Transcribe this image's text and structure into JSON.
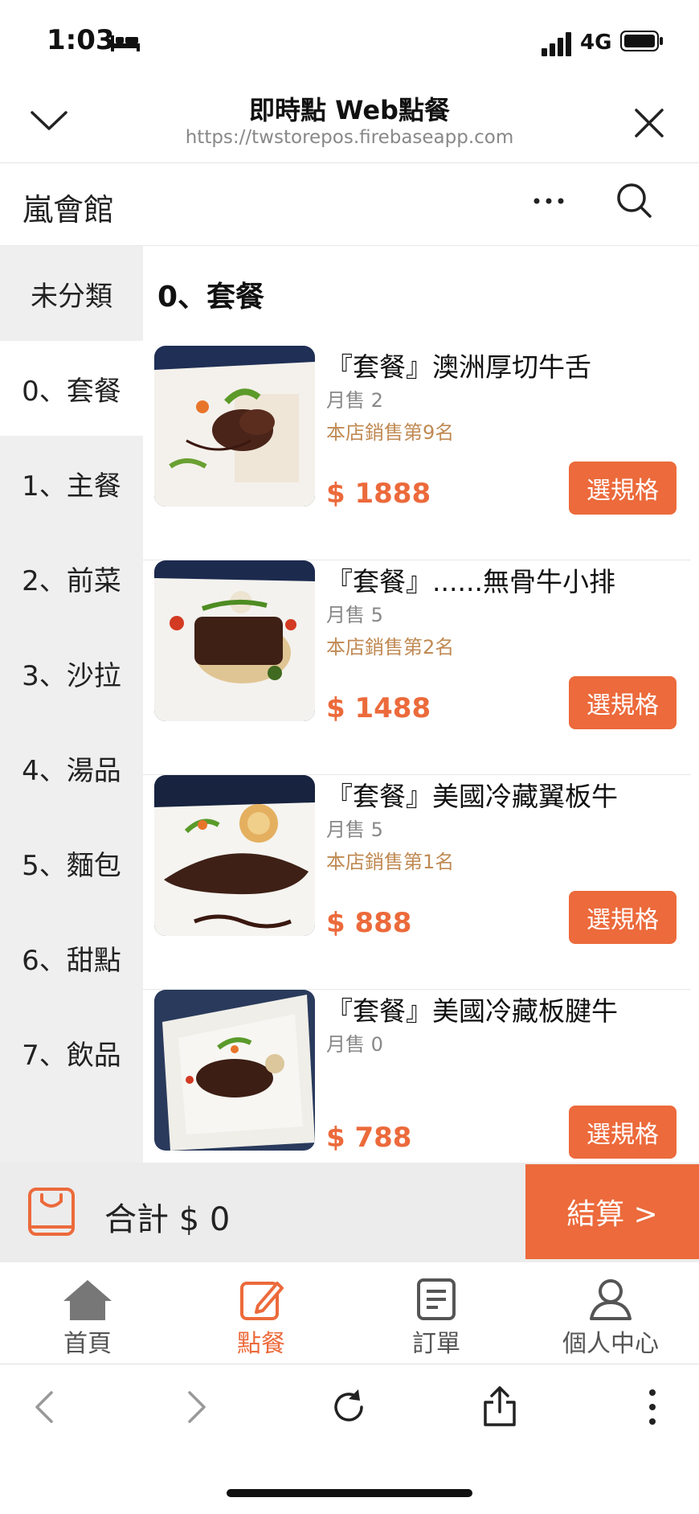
{
  "status": {
    "time": "1:03",
    "network": "4G"
  },
  "browser": {
    "title": "即時點 Web點餐",
    "url": "https://twstorepos.firebaseapp.com"
  },
  "shop": {
    "name": "嵐會館"
  },
  "categories": [
    {
      "label": "未分類"
    },
    {
      "label": "0、套餐"
    },
    {
      "label": "1、主餐"
    },
    {
      "label": "2、前菜"
    },
    {
      "label": "3、沙拉"
    },
    {
      "label": "4、湯品"
    },
    {
      "label": "5、麵包"
    },
    {
      "label": "6、甜點"
    },
    {
      "label": "7、飲品"
    }
  ],
  "section": {
    "title": "0、套餐"
  },
  "items": [
    {
      "name": "『套餐』澳洲厚切牛舌",
      "sold": "月售 2",
      "rank": "本店銷售第9名",
      "price": "$ 1888",
      "button": "選規格"
    },
    {
      "name": "『套餐』......無骨牛小排",
      "sold": "月售 5",
      "rank": "本店銷售第2名",
      "price": "$ 1488",
      "button": "選規格"
    },
    {
      "name": "『套餐』美國冷藏翼板牛",
      "sold": "月售 5",
      "rank": "本店銷售第1名",
      "price": "$ 888",
      "button": "選規格"
    },
    {
      "name": "『套餐』美國冷藏板腱牛",
      "sold": "月售 0",
      "rank": "",
      "price": "$ 788",
      "button": "選規格"
    }
  ],
  "cart": {
    "total": "合計 $ 0",
    "checkout": "結算 >"
  },
  "tabs": [
    {
      "label": "首頁",
      "icon": "home-icon"
    },
    {
      "label": "點餐",
      "icon": "edit-icon"
    },
    {
      "label": "訂單",
      "icon": "document-icon"
    },
    {
      "label": "個人中心",
      "icon": "user-icon"
    }
  ],
  "colors": {
    "accent": "#ec6a3b",
    "rank": "#c08a54",
    "sidebar_bg": "#efefef"
  }
}
